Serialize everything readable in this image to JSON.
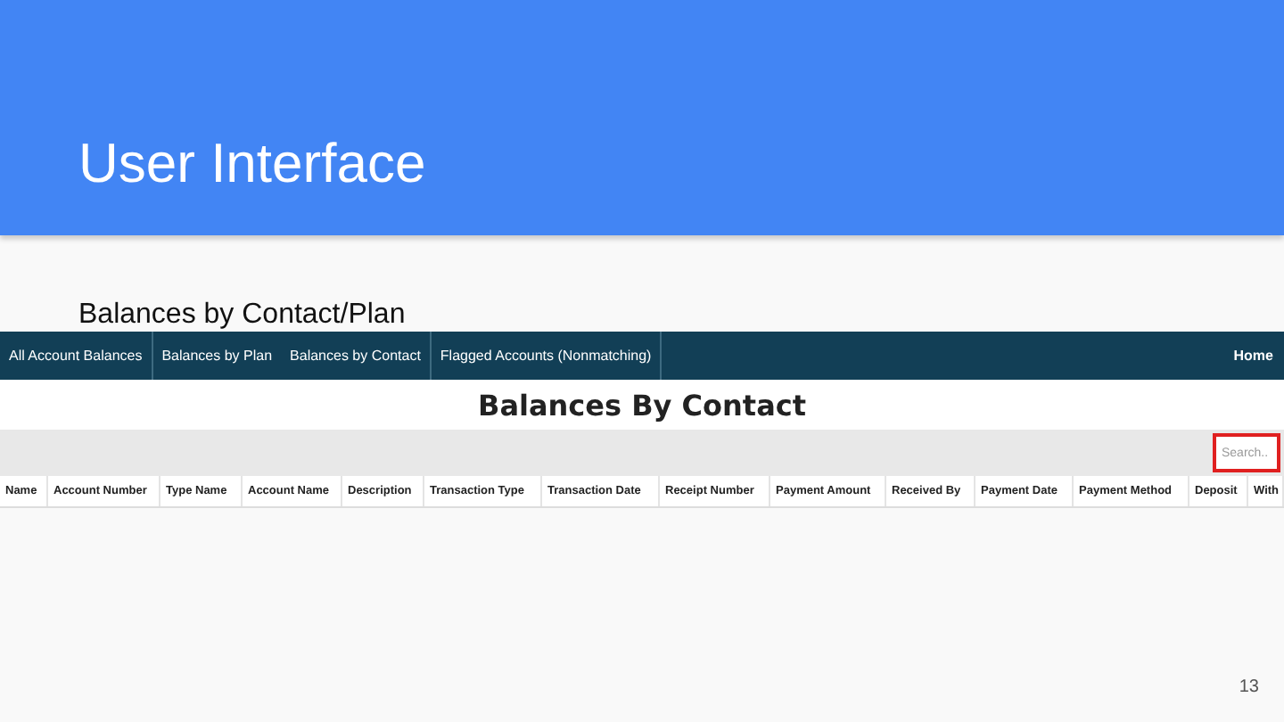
{
  "slide": {
    "title": "User Interface",
    "subtitle": "Balances by Contact/Plan",
    "page_number": "13"
  },
  "app": {
    "nav": [
      {
        "label": "All Account Balances",
        "divider": true
      },
      {
        "label": "Balances by Plan",
        "divider": false
      },
      {
        "label": "Balances by Contact",
        "divider": true
      },
      {
        "label": "Flagged Accounts (Nonmatching)",
        "divider": true
      }
    ],
    "home": "Home",
    "heading": "Balances By Contact",
    "search": {
      "placeholder": "Search..",
      "highlighted": true
    },
    "columns": [
      "Name",
      "Account Number",
      "Type Name",
      "Account Name",
      "Description",
      "Transaction Type",
      "Transaction Date",
      "Receipt Number",
      "Payment Amount",
      "Received By",
      "Payment Date",
      "Payment Method",
      "Deposit",
      "With"
    ]
  }
}
